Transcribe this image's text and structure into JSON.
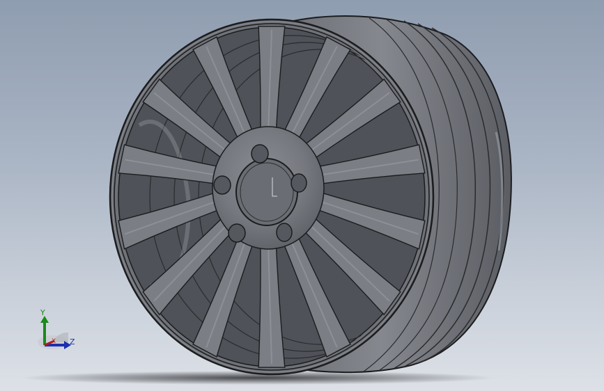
{
  "viewport": {
    "background_top": "#8f9db0",
    "background_bottom": "#dde1e7",
    "model_color": "#7d8086",
    "edge_color": "#1b1c1e"
  },
  "model": {
    "type": "wheel-rim",
    "spoke_count": 14,
    "lug_holes": 5
  },
  "triad": {
    "y_label": "Y",
    "z_label": "Z",
    "x_label": "X",
    "y_color": "#1a8a1a",
    "z_color": "#1c2fb0",
    "x_color": "#b01c1c"
  }
}
